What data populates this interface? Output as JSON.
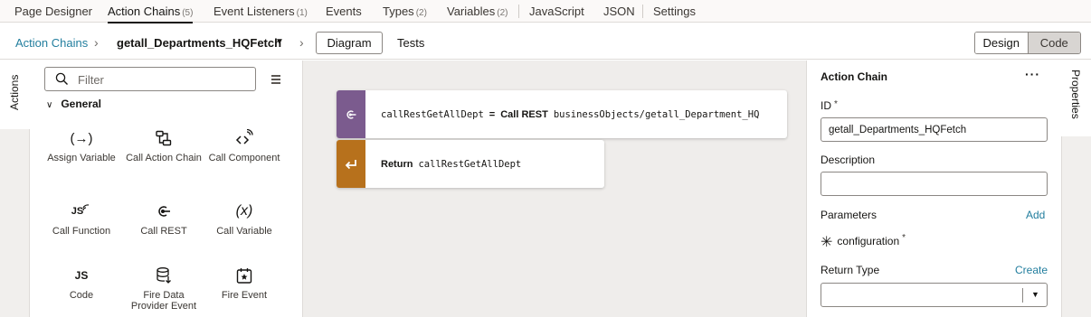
{
  "top_tabs": [
    {
      "label": "Page Designer",
      "count": ""
    },
    {
      "label": "Action Chains",
      "count": "(5)"
    },
    {
      "label": "Event Listeners",
      "count": "(1)"
    },
    {
      "label": "Events",
      "count": ""
    },
    {
      "label": "Types",
      "count": "(2)"
    },
    {
      "label": "Variables",
      "count": "(2)"
    },
    {
      "label": "JavaScript",
      "count": ""
    },
    {
      "label": "JSON",
      "count": ""
    },
    {
      "label": "Settings",
      "count": ""
    }
  ],
  "active_tab": "Action Chains",
  "breadcrumb": {
    "parent": "Action Chains",
    "current": "getall_Departments_HQFetch"
  },
  "view_tabs": {
    "diagram": "Diagram",
    "tests": "Tests"
  },
  "mode_toggle": {
    "design": "Design",
    "code": "Code",
    "selected": "Code"
  },
  "left_panel": {
    "vertical_tab": "Actions",
    "filter_placeholder": "Filter",
    "group": "General",
    "items": [
      {
        "label": "Assign Variable",
        "icon": "assign-variable-icon",
        "glyph": "(→)"
      },
      {
        "label": "Call Action Chain",
        "icon": "call-action-chain-icon",
        "glyph": ""
      },
      {
        "label": "Call Component",
        "icon": "call-component-icon",
        "glyph": ""
      },
      {
        "label": "Call Function",
        "icon": "call-function-icon",
        "glyph": "JS"
      },
      {
        "label": "Call REST",
        "icon": "call-rest-icon",
        "glyph": ""
      },
      {
        "label": "Call Variable",
        "icon": "call-variable-icon",
        "glyph": "(x)"
      },
      {
        "label": "Code",
        "icon": "code-icon",
        "glyph": "JS"
      },
      {
        "label": "Fire Data Provider Event",
        "icon": "fire-data-provider-event-icon",
        "glyph": ""
      },
      {
        "label": "Fire Event",
        "icon": "fire-event-icon",
        "glyph": ""
      }
    ]
  },
  "diagram": {
    "call_rest": {
      "result_var": "callRestGetAllDept",
      "operator": "=",
      "action": "Call REST",
      "endpoint": "businessObjects/getall_Department_HQ",
      "color": "#7b5b8e",
      "icon": "call-rest-icon"
    },
    "return": {
      "keyword": "Return",
      "value": "callRestGetAllDept",
      "color": "#b7711c",
      "icon": "return-icon"
    }
  },
  "properties": {
    "vertical_tab": "Properties",
    "title": "Action Chain",
    "id_label": "ID",
    "required_mark": "*",
    "id_value": "getall_Departments_HQFetch",
    "description_label": "Description",
    "description_value": "",
    "parameters_label": "Parameters",
    "add_label": "Add",
    "parameter_name": "configuration",
    "return_type_label": "Return Type",
    "create_label": "Create",
    "return_type_value": ""
  }
}
